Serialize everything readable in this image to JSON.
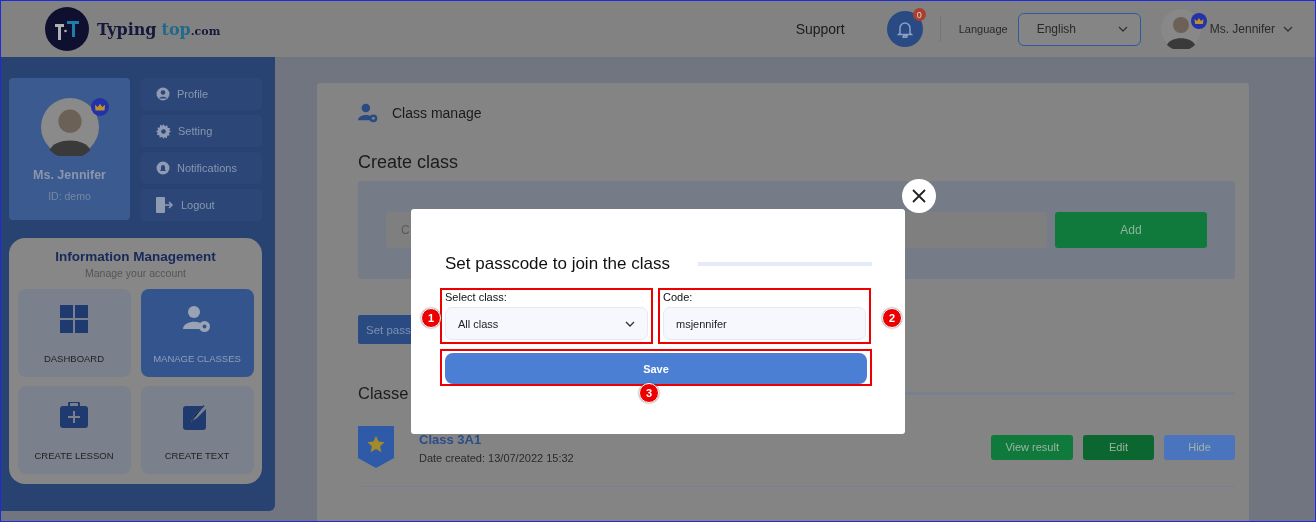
{
  "header": {
    "logo": {
      "word": "Typing",
      "accent": "top",
      "suffix": ".com"
    },
    "support": "Support",
    "notifications": {
      "count": "0"
    },
    "language_label": "Language",
    "language": "English",
    "user": "Ms. Jennifer"
  },
  "sidebar": {
    "profile": {
      "name": "Ms. Jennifer",
      "id": "ID: demo"
    },
    "menu": [
      {
        "label": "Profile"
      },
      {
        "label": "Setting"
      },
      {
        "label": "Notifications"
      },
      {
        "label": "Logout"
      }
    ],
    "info": {
      "title": "Information Management",
      "subtitle": "Manage your account",
      "tiles": [
        {
          "label": "DASHBOARD",
          "selected": false
        },
        {
          "label": "MANAGE CLASSES",
          "selected": true
        },
        {
          "label": "CREATE LESSON",
          "selected": false
        },
        {
          "label": "CREATE TEXT",
          "selected": false
        }
      ]
    }
  },
  "main": {
    "title": "Class manage",
    "create_heading": "Create class",
    "create_placeholder": "C",
    "add_button": "Add",
    "set_passcode_button": "Set pass",
    "classes_heading": "Classe",
    "classes": [
      {
        "name": "Class 3A1",
        "date": "Date created: 13/07/2022 15:32",
        "actions": [
          {
            "label": "View result",
            "color": "#0f7a3b"
          },
          {
            "label": "Edit",
            "color": "#0b6630"
          },
          {
            "label": "Hide",
            "color": "#4a74bd"
          }
        ]
      }
    ]
  },
  "modal": {
    "title": "Set passcode to join the class",
    "select_label": "Select class:",
    "select_value": "All class",
    "code_label": "Code:",
    "code_value": "msjennifer",
    "save": "Save",
    "markers": [
      "1",
      "2",
      "3"
    ]
  }
}
